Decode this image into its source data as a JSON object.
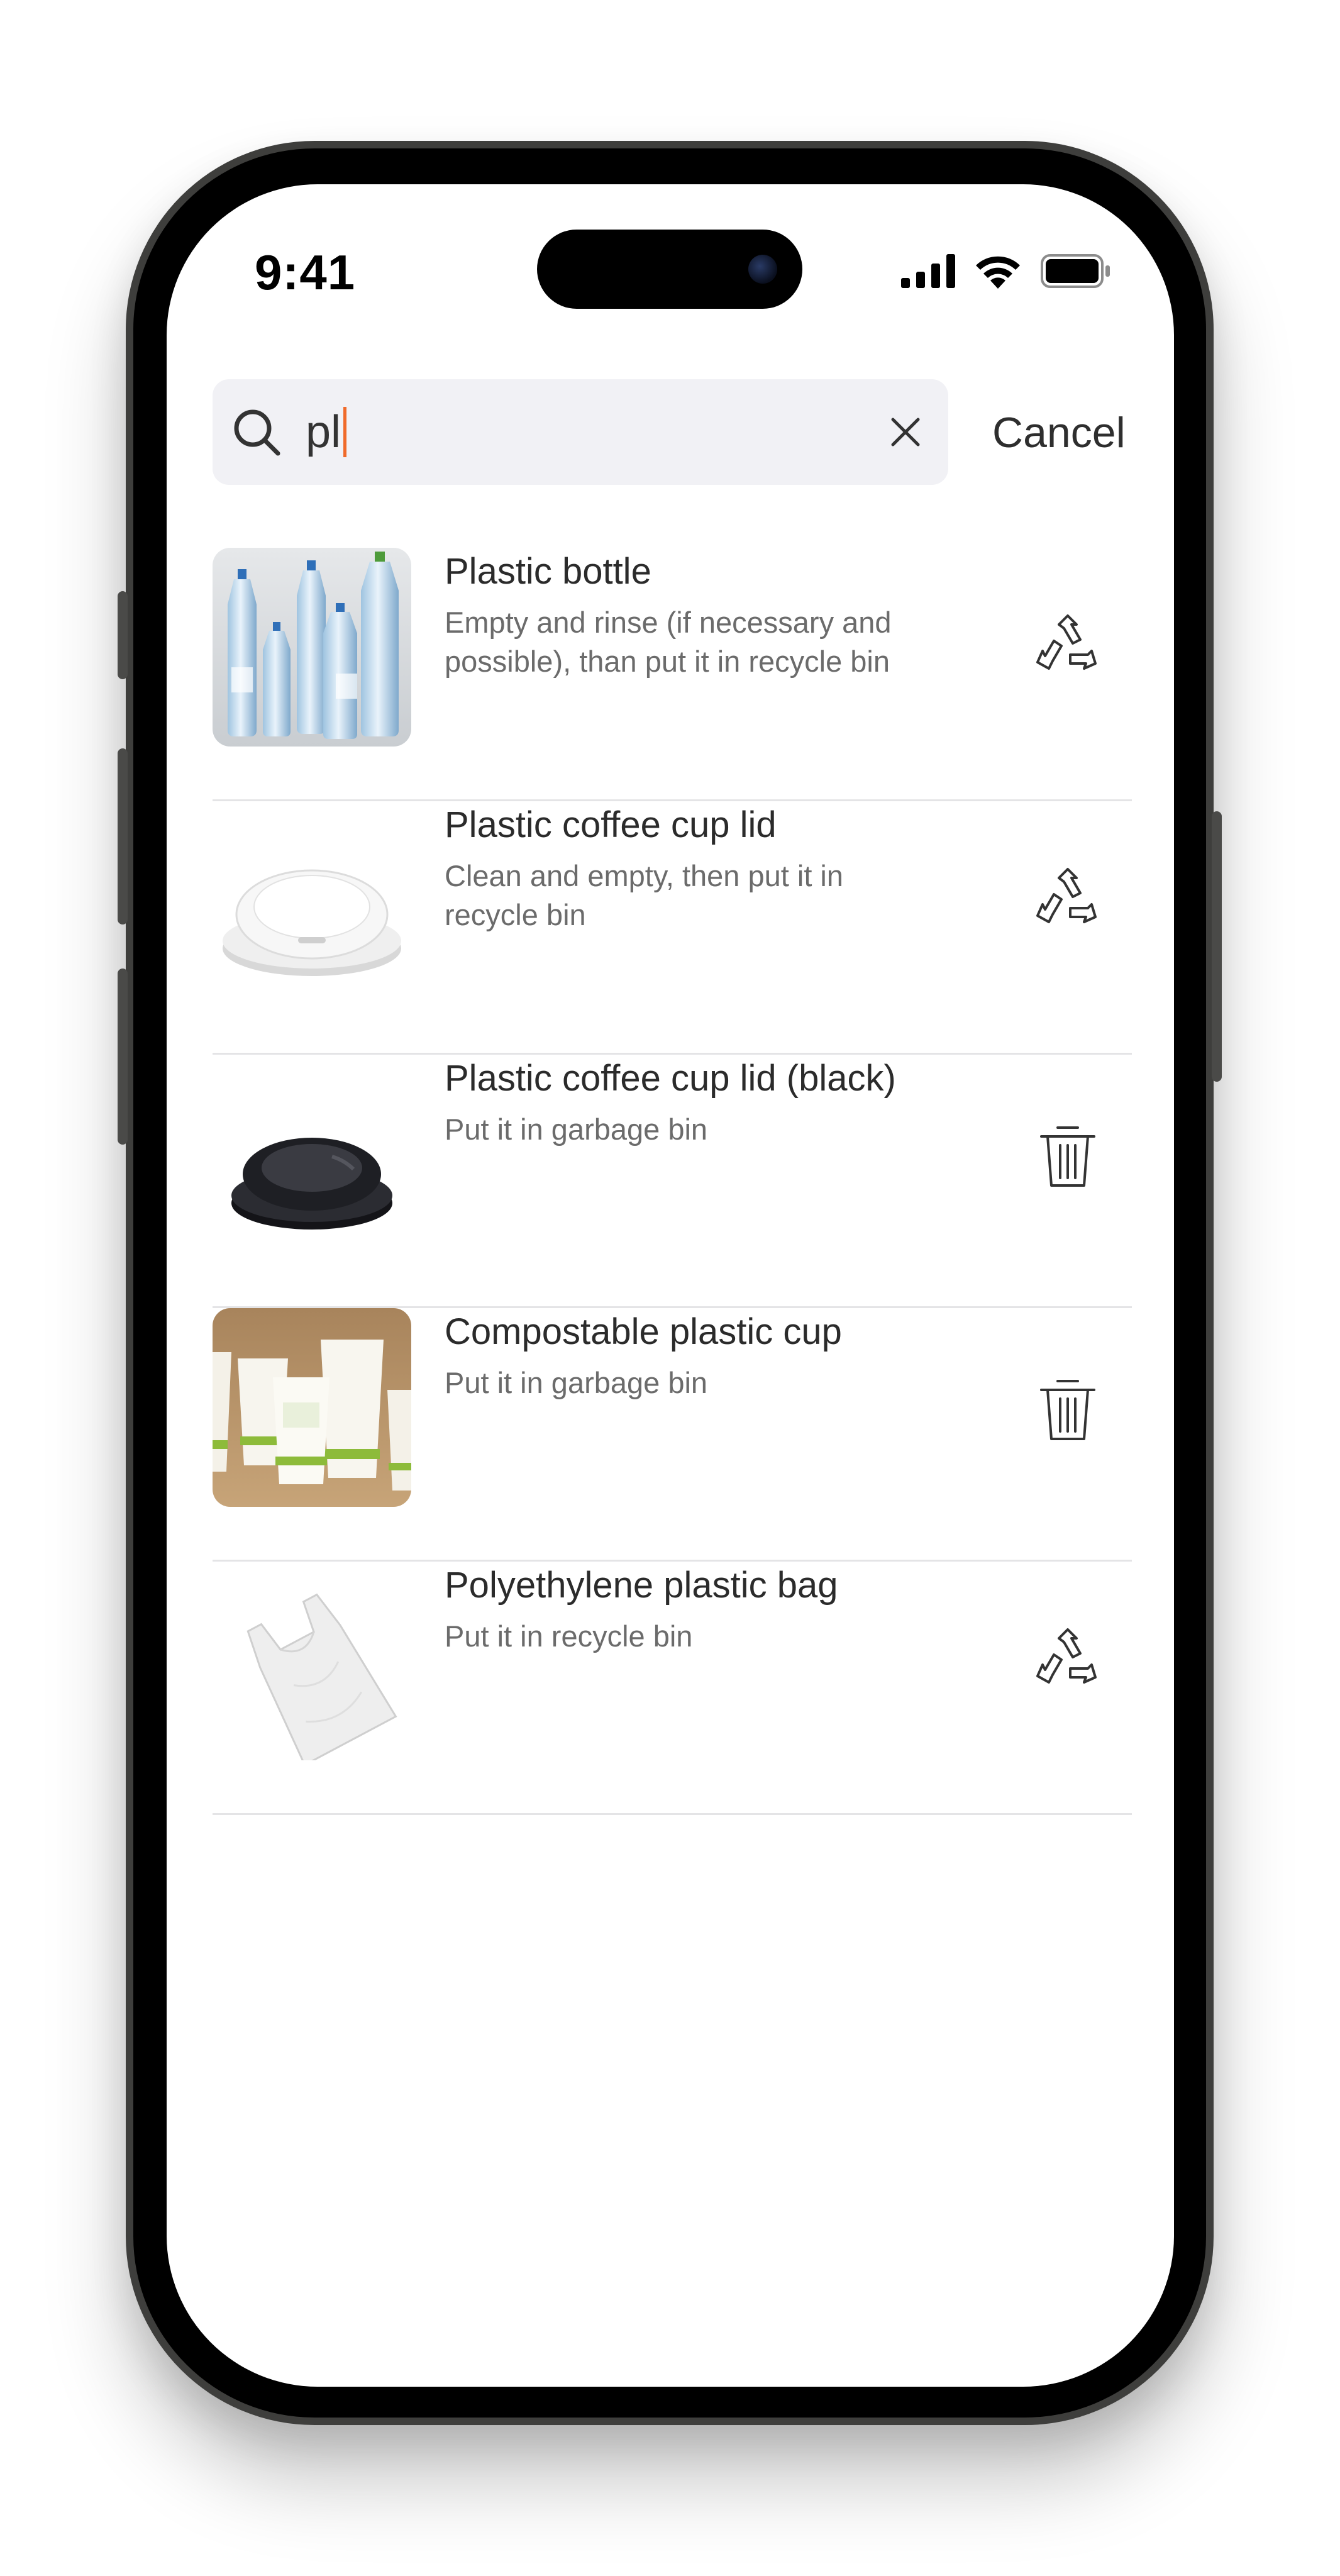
{
  "status_bar": {
    "time": "9:41",
    "icons": [
      "signal-icon",
      "wifi-icon",
      "battery-icon"
    ]
  },
  "search": {
    "value": "pl",
    "cancel_label": "Cancel",
    "caret_color": "#f06a2a"
  },
  "results": [
    {
      "title": "Plastic bottle",
      "description": "Empty and rinse (if necessary and possible), than put it in recycle bin",
      "image": "plastic-bottles-image",
      "action_icon": "recycle-icon"
    },
    {
      "title": "Plastic coffee cup lid",
      "description": "Clean and empty, then put it in recycle bin",
      "image": "white-cup-lid-image",
      "action_icon": "recycle-icon"
    },
    {
      "title": "Plastic coffee cup lid (black)",
      "description": "Put it in garbage bin",
      "image": "black-cup-lid-image",
      "action_icon": "trash-icon"
    },
    {
      "title": "Compostable plastic cup",
      "description": "Put it in garbage bin",
      "image": "compostable-cups-image",
      "action_icon": "trash-icon"
    },
    {
      "title": "Polyethylene plastic bag",
      "description": "Put it in recycle bin",
      "image": "plastic-bag-image",
      "action_icon": "recycle-icon"
    }
  ]
}
